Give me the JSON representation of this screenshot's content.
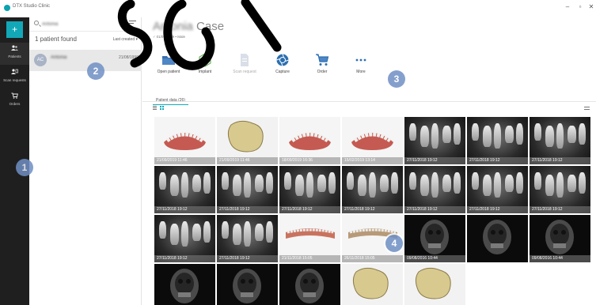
{
  "window": {
    "app_title": "DTX Studio Clinic",
    "minimize": "–",
    "restore": "▫",
    "close": "✕"
  },
  "nav": {
    "add_label": "+",
    "items": [
      {
        "label": "Patients",
        "icon": "patients-icon"
      },
      {
        "label": "Scan requests",
        "icon": "scan-request-icon"
      },
      {
        "label": "Orders",
        "icon": "cart-icon"
      }
    ]
  },
  "patient_list": {
    "search_value": "Antonia",
    "found_text": "1 patient found",
    "sort_label": "Last created ▾",
    "patient": {
      "initials": "AC",
      "name": "Antonia",
      "date": "21/08/1999"
    }
  },
  "case": {
    "first_name": "Antonia",
    "title": "Case",
    "subtitle": "♂ 01/09/1999 • Male"
  },
  "toolbar": [
    {
      "label": "Open patient",
      "icon": "folder-icon",
      "disabled": false
    },
    {
      "label": "Implant",
      "icon": "implant-icon",
      "disabled": false
    },
    {
      "label": "Scan request",
      "icon": "document-icon",
      "disabled": true
    },
    {
      "label": "Capture",
      "icon": "aperture-icon",
      "disabled": false
    },
    {
      "label": "Order",
      "icon": "cart-icon",
      "disabled": false
    },
    {
      "label": "More",
      "icon": "more-icon",
      "disabled": false
    }
  ],
  "tabs": {
    "patient_data": "Patient data (26)"
  },
  "thumbnails": [
    {
      "kind": "model-pink",
      "time": "21/09/2019 11:46"
    },
    {
      "kind": "model-beige",
      "time": "21/09/2019 11:46"
    },
    {
      "kind": "model-pink2",
      "time": "18/09/2019 16:36"
    },
    {
      "kind": "model-pink3",
      "time": "15/02/2019 13:14"
    },
    {
      "kind": "xray",
      "time": "27/11/2018 19:12"
    },
    {
      "kind": "xray",
      "time": "27/11/2018 19:12"
    },
    {
      "kind": "xray",
      "time": "27/11/2018 19:12"
    },
    {
      "kind": "xray",
      "time": "27/11/2018 19:12"
    },
    {
      "kind": "xray",
      "time": "27/11/2018 19:12"
    },
    {
      "kind": "xray",
      "time": "27/11/2018 19:12"
    },
    {
      "kind": "xray",
      "time": "27/11/2018 19:12"
    },
    {
      "kind": "xray",
      "time": "27/11/2018 19:12"
    },
    {
      "kind": "xray",
      "time": "27/11/2018 19:12"
    },
    {
      "kind": "xray",
      "time": "27/11/2018 19:12"
    },
    {
      "kind": "xray",
      "time": "27/11/2018 19:12"
    },
    {
      "kind": "xray",
      "time": "27/11/2018 19:12"
    },
    {
      "kind": "model-arch",
      "time": "21/11/2018 15:05"
    },
    {
      "kind": "model-side",
      "time": "26/11/2018 15:05"
    },
    {
      "kind": "ct",
      "time": "09/08/2016 10:44"
    },
    {
      "kind": "ct",
      "time": ""
    },
    {
      "kind": "ct",
      "time": "09/08/2016 10:44"
    },
    {
      "kind": "ct",
      "time": ""
    },
    {
      "kind": "ct",
      "time": ""
    },
    {
      "kind": "ct",
      "time": ""
    },
    {
      "kind": "model-beige",
      "time": ""
    },
    {
      "kind": "model-beige2",
      "time": ""
    }
  ],
  "callouts": [
    "1",
    "2",
    "3",
    "4"
  ],
  "colors": {
    "accent": "#12a8b8",
    "nav_bg": "#1f1f1f",
    "callout": "#6f8fc4"
  }
}
